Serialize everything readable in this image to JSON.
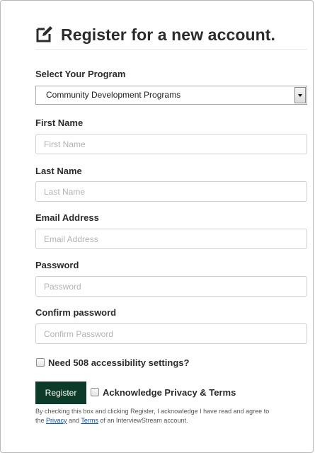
{
  "header": {
    "title": "Register for a new account.",
    "icon": "edit-icon"
  },
  "program": {
    "label": "Select Your Program",
    "selected": "Community Development Programs"
  },
  "fields": {
    "first_name": {
      "label": "First Name",
      "placeholder": "First Name",
      "value": ""
    },
    "last_name": {
      "label": "Last Name",
      "placeholder": "Last Name",
      "value": ""
    },
    "email": {
      "label": "Email Address",
      "placeholder": "Email Address",
      "value": ""
    },
    "password": {
      "label": "Password",
      "placeholder": "Password",
      "value": ""
    },
    "confirm_password": {
      "label": "Confirm password",
      "placeholder": "Confirm Password",
      "value": ""
    }
  },
  "accessibility": {
    "label": "Need 508 accessibility settings?",
    "checked": false
  },
  "register": {
    "button_label": "Register"
  },
  "acknowledge": {
    "label": "Acknowledge Privacy & Terms",
    "checked": false
  },
  "fine_print": {
    "prefix": "By checking this box and clicking Register, I acknowledge I have read and agree to the ",
    "privacy_link": "Privacy",
    "and": " and ",
    "terms_link": "Terms",
    "suffix": " of an InterviewStream account."
  },
  "colors": {
    "register_button": "#0c3b2a",
    "link": "#1a4d9e"
  }
}
